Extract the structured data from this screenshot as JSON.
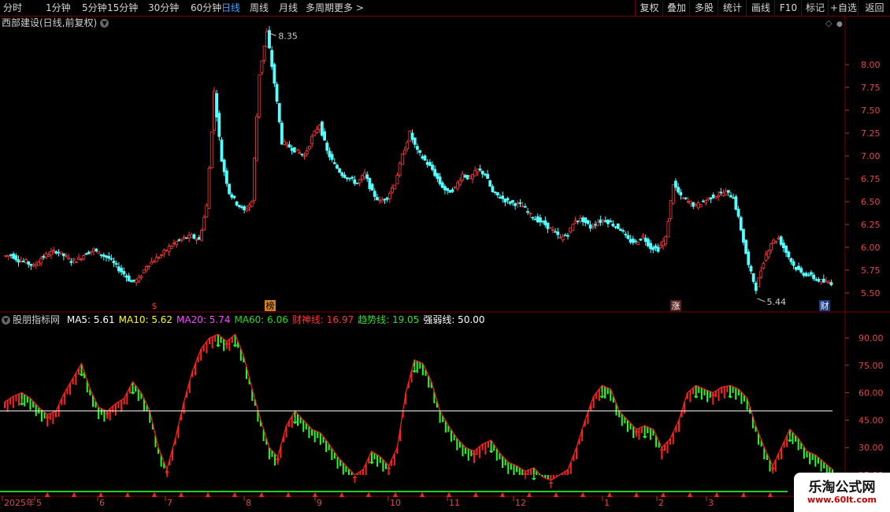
{
  "toolbar": {
    "periods": [
      "分时",
      "1分钟",
      "5分钟",
      "15分钟",
      "30分钟",
      "60分钟",
      "日线",
      "周线",
      "月线",
      "多周期",
      "更多 >"
    ],
    "active_period": "日线",
    "buttons": [
      "复权",
      "叠加",
      "多股",
      "统计",
      "画线",
      "F10",
      "标记",
      "+自选",
      "返回"
    ]
  },
  "stock": {
    "title": "西部建设(日线,前复权)"
  },
  "price_axis": {
    "ticks": [
      "8.00",
      "7.75",
      "7.50",
      "7.25",
      "7.00",
      "6.75",
      "6.50",
      "6.25",
      "6.00",
      "5.75",
      "5.50"
    ]
  },
  "price_annotations": {
    "high": "8.35",
    "low": "5.44"
  },
  "event_marks": [
    {
      "text": "$"
    },
    {
      "text": "榜"
    },
    {
      "text": "涨"
    },
    {
      "text": "财"
    }
  ],
  "indicator": {
    "name": "股朋指标网",
    "items": [
      {
        "label": "MA5:",
        "value": "5.61",
        "color": "#ffffff"
      },
      {
        "label": "MA10:",
        "value": "5.62",
        "color": "#ffff00"
      },
      {
        "label": "MA20:",
        "value": "5.74",
        "color": "#ff44ff"
      },
      {
        "label": "MA60:",
        "value": "6.06",
        "color": "#22dd22"
      },
      {
        "label": "财神线:",
        "value": "16.97",
        "color": "#ff3333"
      },
      {
        "label": "趋势线:",
        "value": "19.05",
        "color": "#33dd33"
      },
      {
        "label": "强弱线:",
        "value": "50.00",
        "color": "#ffffff"
      }
    ]
  },
  "indicator_axis": {
    "ticks": [
      "90.00",
      "75.00",
      "60.00",
      "45.00",
      "30.00",
      "15.00"
    ]
  },
  "time_axis": {
    "labels": [
      "2025年",
      "5",
      "6",
      "7",
      "8",
      "9",
      "10",
      "11",
      "12",
      "1",
      "2",
      "3"
    ]
  },
  "watermark": {
    "name": "乐淘公式网",
    "url": "www.60lt.com"
  },
  "colors": {
    "up": "#ff3b3b",
    "down": "#54ffff",
    "osc_up": "#ff2020",
    "osc_down": "#22ff22",
    "grid": "#7a0000"
  },
  "chart_data": {
    "type": "candlestick",
    "title": "西部建设(日线,前复权)",
    "y_range": [
      5.35,
      8.45
    ],
    "high": 8.35,
    "low": 5.44,
    "price_series": [
      5.9,
      5.92,
      5.86,
      5.84,
      5.79,
      5.88,
      5.93,
      5.96,
      5.91,
      5.85,
      5.87,
      5.94,
      5.97,
      5.92,
      5.88,
      5.79,
      5.71,
      5.62,
      5.65,
      5.8,
      5.86,
      5.92,
      6.0,
      6.06,
      6.1,
      6.12,
      6.08,
      6.45,
      7.7,
      6.95,
      6.6,
      6.48,
      6.4,
      6.5,
      7.9,
      8.35,
      7.8,
      7.15,
      7.1,
      7.05,
      7.0,
      7.2,
      7.35,
      7.05,
      6.9,
      6.8,
      6.75,
      6.7,
      6.8,
      6.6,
      6.5,
      6.55,
      6.7,
      7.0,
      7.25,
      7.05,
      6.95,
      6.85,
      6.7,
      6.6,
      6.65,
      6.8,
      6.75,
      6.85,
      6.8,
      6.6,
      6.55,
      6.5,
      6.48,
      6.45,
      6.35,
      6.3,
      6.25,
      6.18,
      6.1,
      6.15,
      6.3,
      6.3,
      6.22,
      6.28,
      6.3,
      6.25,
      6.2,
      6.08,
      6.05,
      6.12,
      6.0,
      5.98,
      6.1,
      6.7,
      6.55,
      6.5,
      6.45,
      6.5,
      6.55,
      6.58,
      6.6,
      6.55,
      6.2,
      5.8,
      5.55,
      5.85,
      6.05,
      6.1,
      5.95,
      5.8,
      5.72,
      5.7,
      5.65,
      5.62,
      5.61
    ],
    "oscillator": {
      "ylim": [
        10,
        100
      ],
      "strong_weak_line": 50,
      "values": [
        55,
        58,
        60,
        57,
        52,
        48,
        50,
        60,
        68,
        76,
        62,
        52,
        50,
        54,
        57,
        66,
        60,
        50,
        30,
        18,
        35,
        55,
        72,
        84,
        90,
        92,
        88,
        92,
        80,
        62,
        45,
        30,
        25,
        42,
        50,
        45,
        40,
        38,
        32,
        25,
        20,
        15,
        18,
        28,
        25,
        20,
        30,
        60,
        78,
        76,
        66,
        50,
        42,
        35,
        30,
        28,
        32,
        34,
        27,
        22,
        20,
        17,
        19,
        14,
        12,
        15,
        18,
        30,
        45,
        58,
        64,
        62,
        50,
        45,
        40,
        42,
        40,
        30,
        35,
        45,
        60,
        64,
        62,
        60,
        63,
        64,
        62,
        57,
        42,
        30,
        20,
        30,
        40,
        35,
        28,
        26,
        22,
        18
      ]
    }
  }
}
